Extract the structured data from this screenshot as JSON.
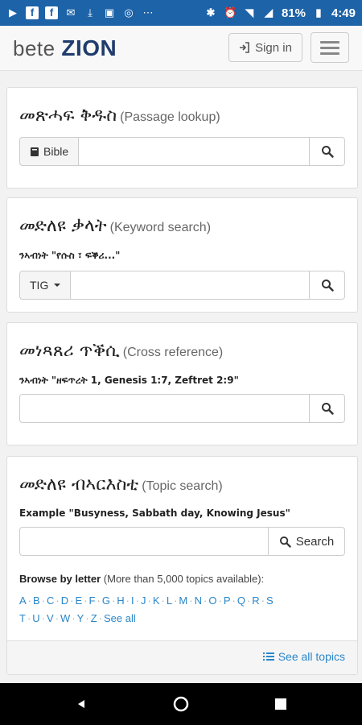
{
  "status_bar": {
    "notification_icons": [
      "play-icon",
      "facebook-icon",
      "facebook-icon",
      "mail-icon",
      "download-icon",
      "photo-icon",
      "messenger-icon",
      "more-icon"
    ],
    "battery": "81%",
    "time": "4:49",
    "network": "4G"
  },
  "header": {
    "brand_prefix": "bete",
    "brand_main": "ZION",
    "signin_label": "Sign in"
  },
  "passage": {
    "title": "መጽሓፍ ቅዱስ",
    "subtitle": "(Passage lookup)",
    "addon_label": "Bible",
    "value": ""
  },
  "keyword": {
    "title": "መድለዩ ቃላት",
    "subtitle": "(Keyword search)",
    "example": "ንኣብነት \"የሱስ ፣ ፍቕሪ...\"",
    "dropdown_label": "TIG",
    "value": ""
  },
  "crossref": {
    "title": "መነጻጸሪ ጥቕሲ",
    "subtitle": "(Cross reference)",
    "example": "ንኣብነት \"ዘፍጥረት 1, Genesis 1:7, Zeftret 2:9\"",
    "value": ""
  },
  "topic": {
    "title": "መድለዩ ብኣርእስቲ",
    "subtitle": "(Topic search)",
    "example": "Example \"Busyness, Sabbath day, Knowing Jesus\"",
    "value": "",
    "search_label": "Search",
    "browse_label": "Browse by letter",
    "browse_note": "(More than 5,000 topics available):",
    "letters_row1": [
      "A",
      "B",
      "C",
      "D",
      "E",
      "F",
      "G",
      "H",
      "I",
      "J",
      "K",
      "L",
      "M",
      "N",
      "O",
      "P",
      "Q",
      "R",
      "S"
    ],
    "letters_row2": [
      "T",
      "U",
      "V",
      "W",
      "Y",
      "Z"
    ],
    "see_all": "See all",
    "see_all_topics": "See all topics"
  },
  "colors": {
    "status_bar": "#1d63a8",
    "link": "#2a86c9",
    "brand_dark": "#1f3c6b"
  }
}
